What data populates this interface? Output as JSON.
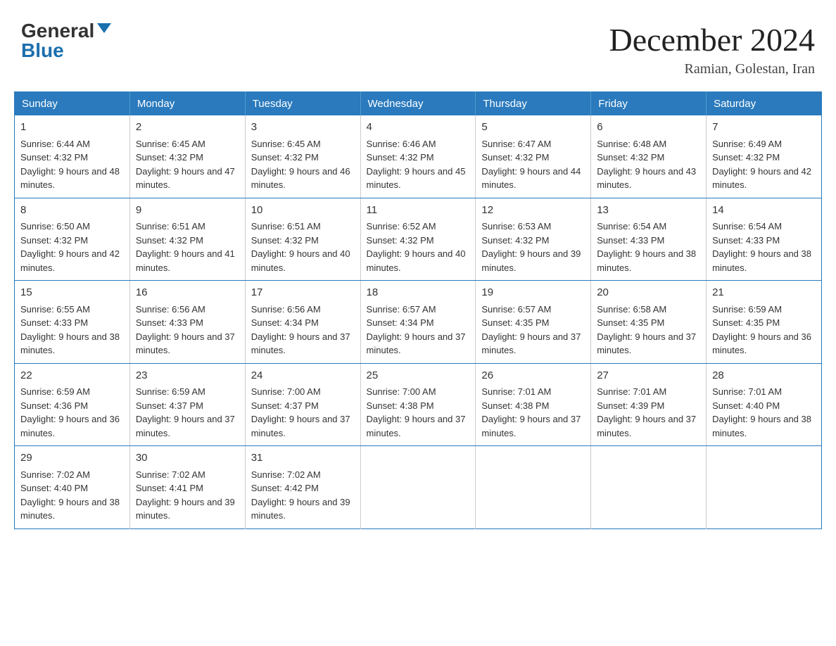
{
  "header": {
    "logo_general": "General",
    "logo_blue": "Blue",
    "month_title": "December 2024",
    "location": "Ramian, Golestan, Iran"
  },
  "columns": [
    "Sunday",
    "Monday",
    "Tuesday",
    "Wednesday",
    "Thursday",
    "Friday",
    "Saturday"
  ],
  "weeks": [
    [
      {
        "day": "1",
        "sunrise": "6:44 AM",
        "sunset": "4:32 PM",
        "daylight": "9 hours and 48 minutes."
      },
      {
        "day": "2",
        "sunrise": "6:45 AM",
        "sunset": "4:32 PM",
        "daylight": "9 hours and 47 minutes."
      },
      {
        "day": "3",
        "sunrise": "6:45 AM",
        "sunset": "4:32 PM",
        "daylight": "9 hours and 46 minutes."
      },
      {
        "day": "4",
        "sunrise": "6:46 AM",
        "sunset": "4:32 PM",
        "daylight": "9 hours and 45 minutes."
      },
      {
        "day": "5",
        "sunrise": "6:47 AM",
        "sunset": "4:32 PM",
        "daylight": "9 hours and 44 minutes."
      },
      {
        "day": "6",
        "sunrise": "6:48 AM",
        "sunset": "4:32 PM",
        "daylight": "9 hours and 43 minutes."
      },
      {
        "day": "7",
        "sunrise": "6:49 AM",
        "sunset": "4:32 PM",
        "daylight": "9 hours and 42 minutes."
      }
    ],
    [
      {
        "day": "8",
        "sunrise": "6:50 AM",
        "sunset": "4:32 PM",
        "daylight": "9 hours and 42 minutes."
      },
      {
        "day": "9",
        "sunrise": "6:51 AM",
        "sunset": "4:32 PM",
        "daylight": "9 hours and 41 minutes."
      },
      {
        "day": "10",
        "sunrise": "6:51 AM",
        "sunset": "4:32 PM",
        "daylight": "9 hours and 40 minutes."
      },
      {
        "day": "11",
        "sunrise": "6:52 AM",
        "sunset": "4:32 PM",
        "daylight": "9 hours and 40 minutes."
      },
      {
        "day": "12",
        "sunrise": "6:53 AM",
        "sunset": "4:32 PM",
        "daylight": "9 hours and 39 minutes."
      },
      {
        "day": "13",
        "sunrise": "6:54 AM",
        "sunset": "4:33 PM",
        "daylight": "9 hours and 38 minutes."
      },
      {
        "day": "14",
        "sunrise": "6:54 AM",
        "sunset": "4:33 PM",
        "daylight": "9 hours and 38 minutes."
      }
    ],
    [
      {
        "day": "15",
        "sunrise": "6:55 AM",
        "sunset": "4:33 PM",
        "daylight": "9 hours and 38 minutes."
      },
      {
        "day": "16",
        "sunrise": "6:56 AM",
        "sunset": "4:33 PM",
        "daylight": "9 hours and 37 minutes."
      },
      {
        "day": "17",
        "sunrise": "6:56 AM",
        "sunset": "4:34 PM",
        "daylight": "9 hours and 37 minutes."
      },
      {
        "day": "18",
        "sunrise": "6:57 AM",
        "sunset": "4:34 PM",
        "daylight": "9 hours and 37 minutes."
      },
      {
        "day": "19",
        "sunrise": "6:57 AM",
        "sunset": "4:35 PM",
        "daylight": "9 hours and 37 minutes."
      },
      {
        "day": "20",
        "sunrise": "6:58 AM",
        "sunset": "4:35 PM",
        "daylight": "9 hours and 37 minutes."
      },
      {
        "day": "21",
        "sunrise": "6:59 AM",
        "sunset": "4:35 PM",
        "daylight": "9 hours and 36 minutes."
      }
    ],
    [
      {
        "day": "22",
        "sunrise": "6:59 AM",
        "sunset": "4:36 PM",
        "daylight": "9 hours and 36 minutes."
      },
      {
        "day": "23",
        "sunrise": "6:59 AM",
        "sunset": "4:37 PM",
        "daylight": "9 hours and 37 minutes."
      },
      {
        "day": "24",
        "sunrise": "7:00 AM",
        "sunset": "4:37 PM",
        "daylight": "9 hours and 37 minutes."
      },
      {
        "day": "25",
        "sunrise": "7:00 AM",
        "sunset": "4:38 PM",
        "daylight": "9 hours and 37 minutes."
      },
      {
        "day": "26",
        "sunrise": "7:01 AM",
        "sunset": "4:38 PM",
        "daylight": "9 hours and 37 minutes."
      },
      {
        "day": "27",
        "sunrise": "7:01 AM",
        "sunset": "4:39 PM",
        "daylight": "9 hours and 37 minutes."
      },
      {
        "day": "28",
        "sunrise": "7:01 AM",
        "sunset": "4:40 PM",
        "daylight": "9 hours and 38 minutes."
      }
    ],
    [
      {
        "day": "29",
        "sunrise": "7:02 AM",
        "sunset": "4:40 PM",
        "daylight": "9 hours and 38 minutes."
      },
      {
        "day": "30",
        "sunrise": "7:02 AM",
        "sunset": "4:41 PM",
        "daylight": "9 hours and 39 minutes."
      },
      {
        "day": "31",
        "sunrise": "7:02 AM",
        "sunset": "4:42 PM",
        "daylight": "9 hours and 39 minutes."
      },
      null,
      null,
      null,
      null
    ]
  ],
  "labels": {
    "sunrise": "Sunrise: ",
    "sunset": "Sunset: ",
    "daylight": "Daylight: "
  }
}
